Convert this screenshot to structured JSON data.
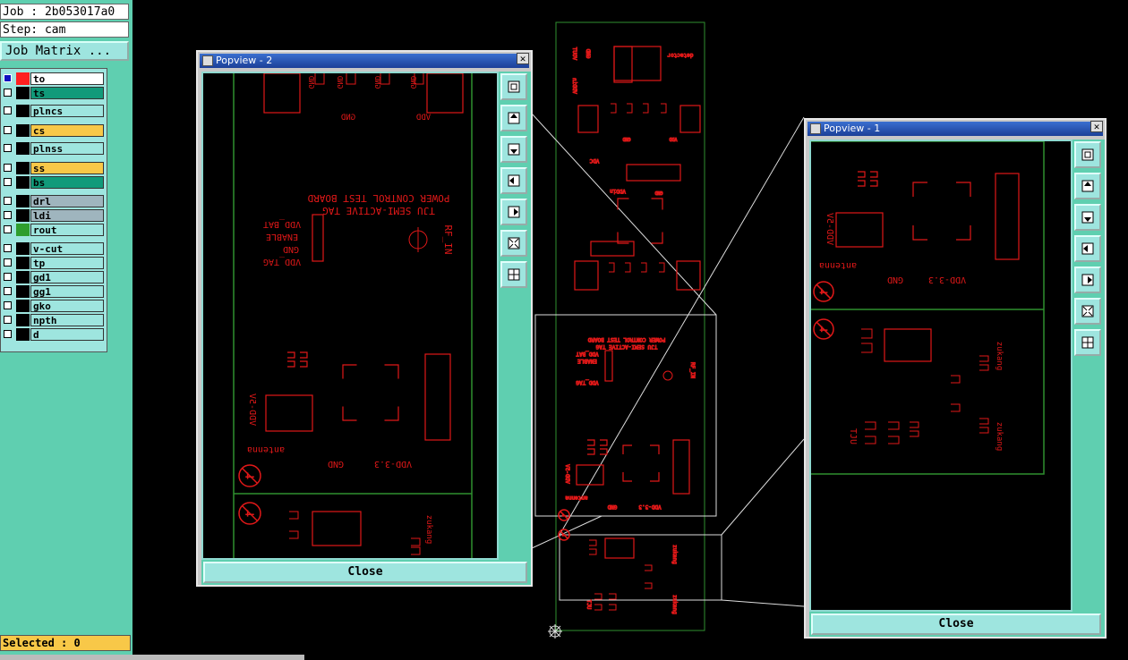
{
  "app": {
    "job_label": "Job : 2b053017a0",
    "step_label": "Step: cam",
    "job_matrix_button": "Job Matrix ...",
    "selected_label": "Selected : 0"
  },
  "layers": [
    {
      "name": "to",
      "color": "#ffffff",
      "swatch": "#ff2020"
    },
    {
      "name": "ts",
      "color": "#119a7a",
      "swatch": "#000000"
    },
    {
      "name": "plncs",
      "color": "#9ee5df",
      "swatch": "#000000"
    },
    {
      "name": "cs",
      "color": "#f8c848",
      "swatch": "#000000"
    },
    {
      "name": "plnss",
      "color": "#9ee5df",
      "swatch": "#000000"
    },
    {
      "name": "ss",
      "color": "#f8c848",
      "swatch": "#000000"
    },
    {
      "name": "bs",
      "color": "#119a7a",
      "swatch": "#000000"
    },
    {
      "name": "drl",
      "color": "#9fb5be",
      "swatch": "#000000"
    },
    {
      "name": "ldi",
      "color": "#9fb5be",
      "swatch": "#000000"
    },
    {
      "name": "rout",
      "color": "#9ee5df",
      "swatch": "#2e9e2e"
    },
    {
      "name": "v-cut",
      "color": "#9ee5df",
      "swatch": "#000000"
    },
    {
      "name": "tp",
      "color": "#9ee5df",
      "swatch": "#000000"
    },
    {
      "name": "gd1",
      "color": "#9ee5df",
      "swatch": "#000000"
    },
    {
      "name": "gg1",
      "color": "#9ee5df",
      "swatch": "#000000"
    },
    {
      "name": "gko",
      "color": "#9ee5df",
      "swatch": "#000000"
    },
    {
      "name": "npth",
      "color": "#9ee5df",
      "swatch": "#000000"
    },
    {
      "name": "d",
      "color": "#9ee5df",
      "swatch": "#000000"
    }
  ],
  "popview2": {
    "title": "Popview - 2",
    "close_x": "✕",
    "close_button": "Close"
  },
  "popview1": {
    "title": "Popview - 1",
    "close_x": "✕",
    "close_button": "Close"
  },
  "board_text": {
    "gnd": "GND",
    "vdd": "VDD",
    "power_control": "POWER CONTROL TEST BOARD",
    "tju_semi": "TJU SEMI-ACTIVE TAG",
    "vdd_bat": "VDD_BAT",
    "enable": "ENABLE",
    "vdd_tag": "VDD_TAG",
    "rf_in": "RF_IN",
    "vdd_5v": "VDD-5V",
    "antenna": "antenna",
    "vdd_33": "VDD-3.3",
    "zukang": "zukang",
    "tju": "TJU",
    "detector": "detector",
    "vout": "VOUT",
    "vddin": "VDDin",
    "vdc": "VDC"
  },
  "colors": {
    "trace": "#e01818",
    "outline": "#2f8f2f",
    "panel": "#5fcfb0",
    "button": "#9ee5df"
  }
}
